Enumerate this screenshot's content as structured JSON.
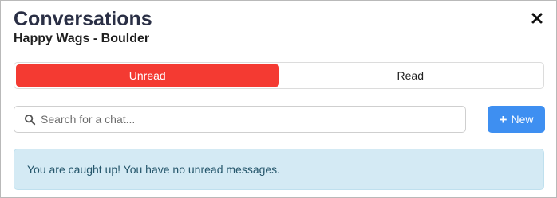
{
  "header": {
    "title": "Conversations",
    "subtitle": "Happy Wags - Boulder",
    "close_icon": "close-icon"
  },
  "tabs": [
    {
      "label": "Unread",
      "active": true
    },
    {
      "label": "Read",
      "active": false
    }
  ],
  "search": {
    "placeholder": "Search for a chat...",
    "value": "",
    "icon": "search-icon"
  },
  "new_button": {
    "label": "New",
    "icon": "plus-icon"
  },
  "alert": {
    "message": "You are caught up! You have no unread messages."
  },
  "colors": {
    "active_tab": "#f43a32",
    "primary_button": "#3e8ff1",
    "alert_background": "#d4eaf4",
    "alert_text": "#25566b",
    "title_text": "#2a2f45"
  }
}
